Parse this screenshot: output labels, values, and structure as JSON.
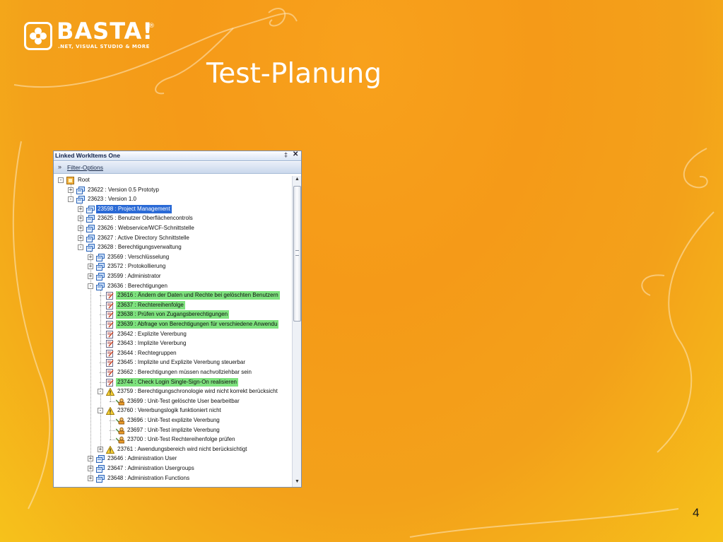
{
  "slide": {
    "title": "Test-Planung",
    "page_number": "4"
  },
  "logo": {
    "wordmark": "BASTA!",
    "registered": "®",
    "tagline": ".NET, VISUAL STUDIO & MORE"
  },
  "colors": {
    "background_orange": "#f59a18",
    "background_yellow": "#f6c21b",
    "highlight_green": "#7ee27e",
    "selection_blue": "#2a6ad6"
  },
  "panel": {
    "title": "Linked WorkItems One",
    "pin_icon": "pin-icon",
    "close_icon": "close-icon",
    "filter_label": "Filter-Options",
    "filter_icon": "double-chevron-down-icon"
  },
  "tree": [
    {
      "level": 0,
      "exp": "-",
      "icon": "root-folder-icon",
      "text": "Root",
      "style": ""
    },
    {
      "level": 1,
      "exp": "+",
      "icon": "workitem-stack-icon",
      "text": "23622 : Version 0.5 Prototyp",
      "style": ""
    },
    {
      "level": 1,
      "exp": "-",
      "icon": "workitem-stack-icon",
      "text": "23623 : Version 1.0",
      "style": ""
    },
    {
      "level": 2,
      "exp": "+",
      "icon": "workitem-stack-icon",
      "text": "23598 : Project Management",
      "style": "selected"
    },
    {
      "level": 2,
      "exp": "+",
      "icon": "workitem-stack-icon",
      "text": "23625 : Benutzer Oberflächencontrols",
      "style": ""
    },
    {
      "level": 2,
      "exp": "+",
      "icon": "workitem-stack-icon",
      "text": "23626 : Webservice/WCF-Schnittstelle",
      "style": ""
    },
    {
      "level": 2,
      "exp": "+",
      "icon": "workitem-stack-icon",
      "text": "23627 : Active Directory Schnittstelle",
      "style": ""
    },
    {
      "level": 2,
      "exp": "-",
      "icon": "workitem-stack-icon",
      "text": "23628 : Berechtigungsverwaltung",
      "style": ""
    },
    {
      "level": 3,
      "exp": "+",
      "icon": "workitem-stack-icon",
      "text": "23569 : Verschlüsselung",
      "style": ""
    },
    {
      "level": 3,
      "exp": "+",
      "icon": "workitem-stack-icon",
      "text": "23572 : Protokollierung",
      "style": ""
    },
    {
      "level": 3,
      "exp": "+",
      "icon": "workitem-stack-icon",
      "text": "23599 : Administrator",
      "style": ""
    },
    {
      "level": 3,
      "exp": "-",
      "icon": "workitem-stack-icon",
      "text": "23636 : Berechtigungen",
      "style": ""
    },
    {
      "level": 4,
      "exp": "",
      "icon": "requirement-note-icon",
      "text": "23616 : Ändern der Daten und Rechte bei gelöschten Benutzern",
      "style": "green"
    },
    {
      "level": 4,
      "exp": "",
      "icon": "requirement-note-icon",
      "text": "23637 : Rechtereihenfolge",
      "style": "green"
    },
    {
      "level": 4,
      "exp": "",
      "icon": "requirement-note-icon",
      "text": "23638 : Prüfen von Zugangsberechtigungen",
      "style": "green"
    },
    {
      "level": 4,
      "exp": "",
      "icon": "requirement-note-icon",
      "text": "23639 : Abfrage von Berechtigungen für verschiedene Anwendu",
      "style": "green"
    },
    {
      "level": 4,
      "exp": "",
      "icon": "requirement-note-icon",
      "text": "23642 : Explizite Vererbung",
      "style": ""
    },
    {
      "level": 4,
      "exp": "",
      "icon": "requirement-note-icon",
      "text": "23643 : Implizite Vererbung",
      "style": ""
    },
    {
      "level": 4,
      "exp": "",
      "icon": "requirement-note-icon",
      "text": "23644 : Rechtegruppen",
      "style": ""
    },
    {
      "level": 4,
      "exp": "",
      "icon": "requirement-note-icon",
      "text": "23645 : Implizite und Explizite Vererbung steuerbar",
      "style": ""
    },
    {
      "level": 4,
      "exp": "",
      "icon": "requirement-note-icon",
      "text": "23662 : Berechtigungen müssen nachvollziehbar sein",
      "style": ""
    },
    {
      "level": 4,
      "exp": "",
      "icon": "requirement-note-icon",
      "text": "23744 : Check Login Single-Sign-On realisieren",
      "style": "green"
    },
    {
      "level": 4,
      "exp": "-",
      "icon": "bug-warning-icon",
      "text": "23759 : Berechtigungschronologie wird nicht korrekt berücksicht",
      "style": ""
    },
    {
      "level": 5,
      "exp": "",
      "icon": "test-case-icon",
      "text": "23699 : Unit-Test gelöschte User bearbeitbar",
      "style": ""
    },
    {
      "level": 4,
      "exp": "-",
      "icon": "bug-warning-icon",
      "text": "23760 : Vererbungslogik funktioniert nicht",
      "style": ""
    },
    {
      "level": 5,
      "exp": "",
      "icon": "test-case-icon",
      "text": "23696 : Unit-Test explizite Vererbung",
      "style": ""
    },
    {
      "level": 5,
      "exp": "",
      "icon": "test-case-icon",
      "text": "23697 : Unit-Test implizite Vererbung",
      "style": ""
    },
    {
      "level": 5,
      "exp": "",
      "icon": "test-case-icon",
      "text": "23700 : Unit-Test Rechtereihenfolge prüfen",
      "style": ""
    },
    {
      "level": 4,
      "exp": "+",
      "icon": "bug-warning-icon",
      "text": "23761 : Awendungsbereich wird nicht berücksichtigt",
      "style": ""
    },
    {
      "level": 3,
      "exp": "+",
      "icon": "workitem-stack-icon",
      "text": "23646 : Administration User",
      "style": ""
    },
    {
      "level": 3,
      "exp": "+",
      "icon": "workitem-stack-icon",
      "text": "23647 : Administration Usergroups",
      "style": ""
    },
    {
      "level": 3,
      "exp": "+",
      "icon": "workitem-stack-icon",
      "text": "23648 : Administration Functions",
      "style": ""
    }
  ]
}
